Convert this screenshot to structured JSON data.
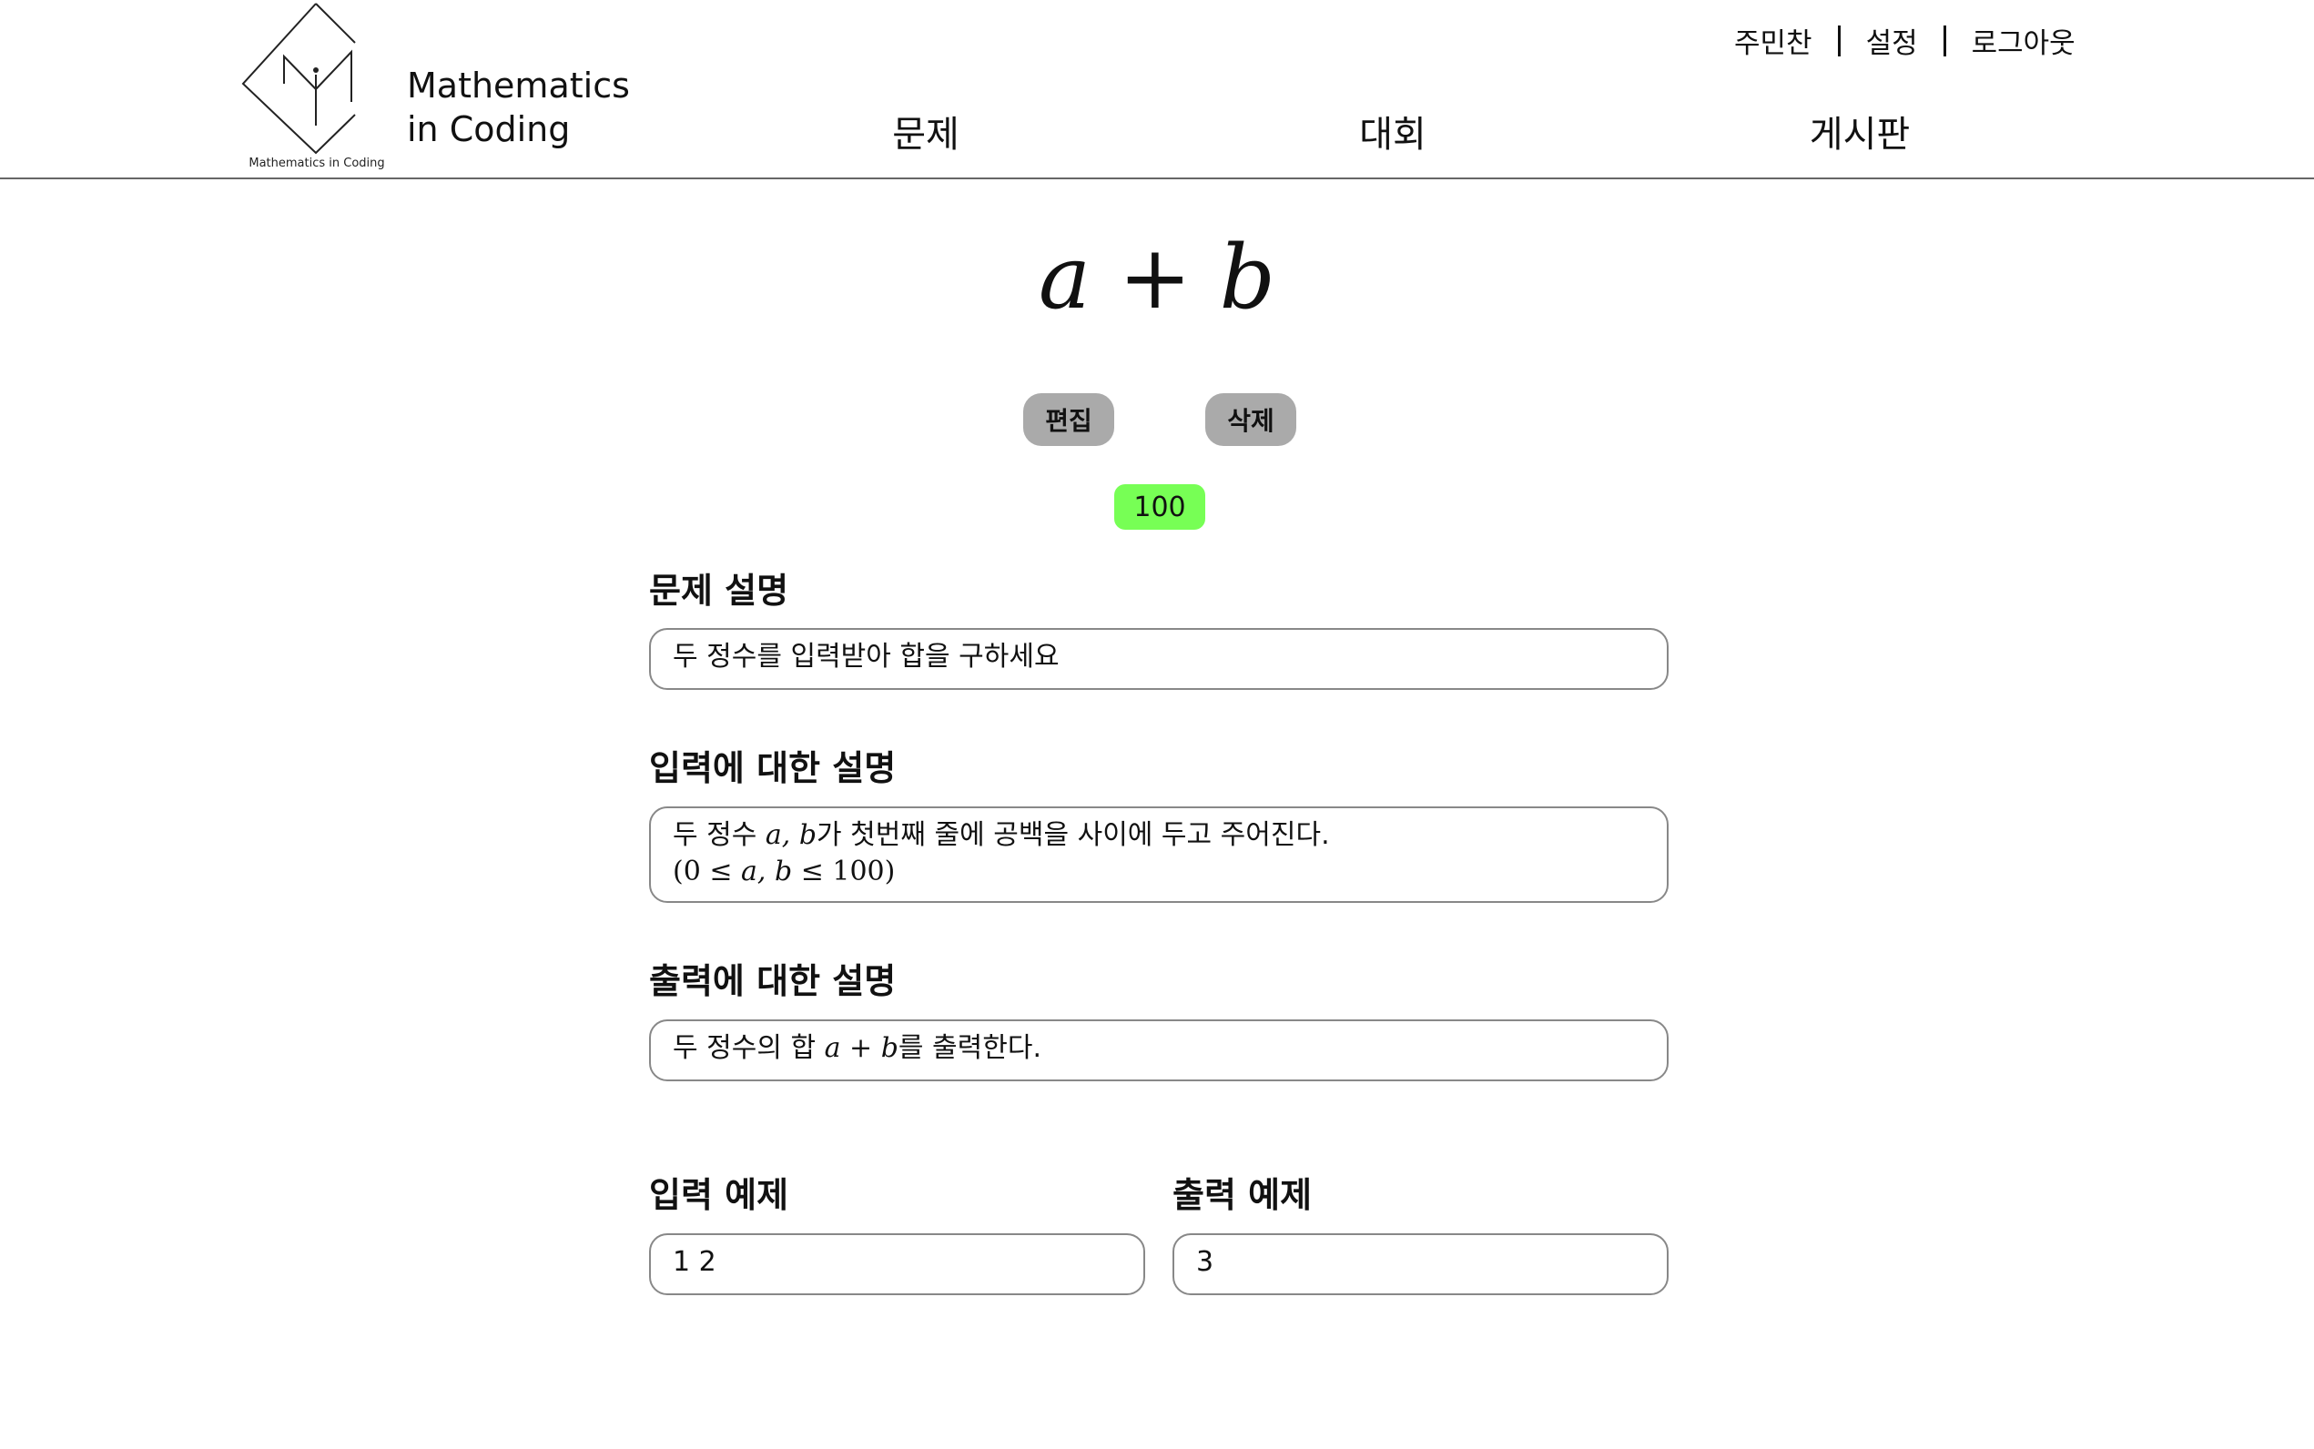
{
  "header": {
    "logo_caption": "Mathematics in Coding",
    "brand_line1": "Mathematics",
    "brand_line2": "in Coding",
    "user_menu": {
      "username": "주민찬",
      "settings": "설정",
      "logout": "로그아웃"
    },
    "nav": {
      "problems": "문제",
      "contests": "대회",
      "board": "게시판"
    }
  },
  "problem": {
    "title_a": "a",
    "title_op": "+",
    "title_b": "b",
    "edit_label": "편집",
    "delete_label": "삭제",
    "score": "100",
    "description_heading": "문제 설명",
    "description_text": "두 정수를 입력받아 합을 구하세요",
    "input_heading": "입력에 대한 설명",
    "input_pre": "두 정수 ",
    "input_vars": "a, b",
    "input_post": "가 첫번째 줄에 공백을 사이에 두고 주어진다.",
    "input_constraint_open": "(0 ≤ ",
    "input_constraint_vars": "a, b",
    "input_constraint_close": " ≤ 100)",
    "output_heading": "출력에 대한 설명",
    "output_pre": "두 정수의 합 ",
    "output_expr": "a + b",
    "output_post": "를 출력한다.",
    "sample_input_heading": "입력 예제",
    "sample_input": "1 2",
    "sample_output_heading": "출력 예제",
    "sample_output": "3"
  }
}
